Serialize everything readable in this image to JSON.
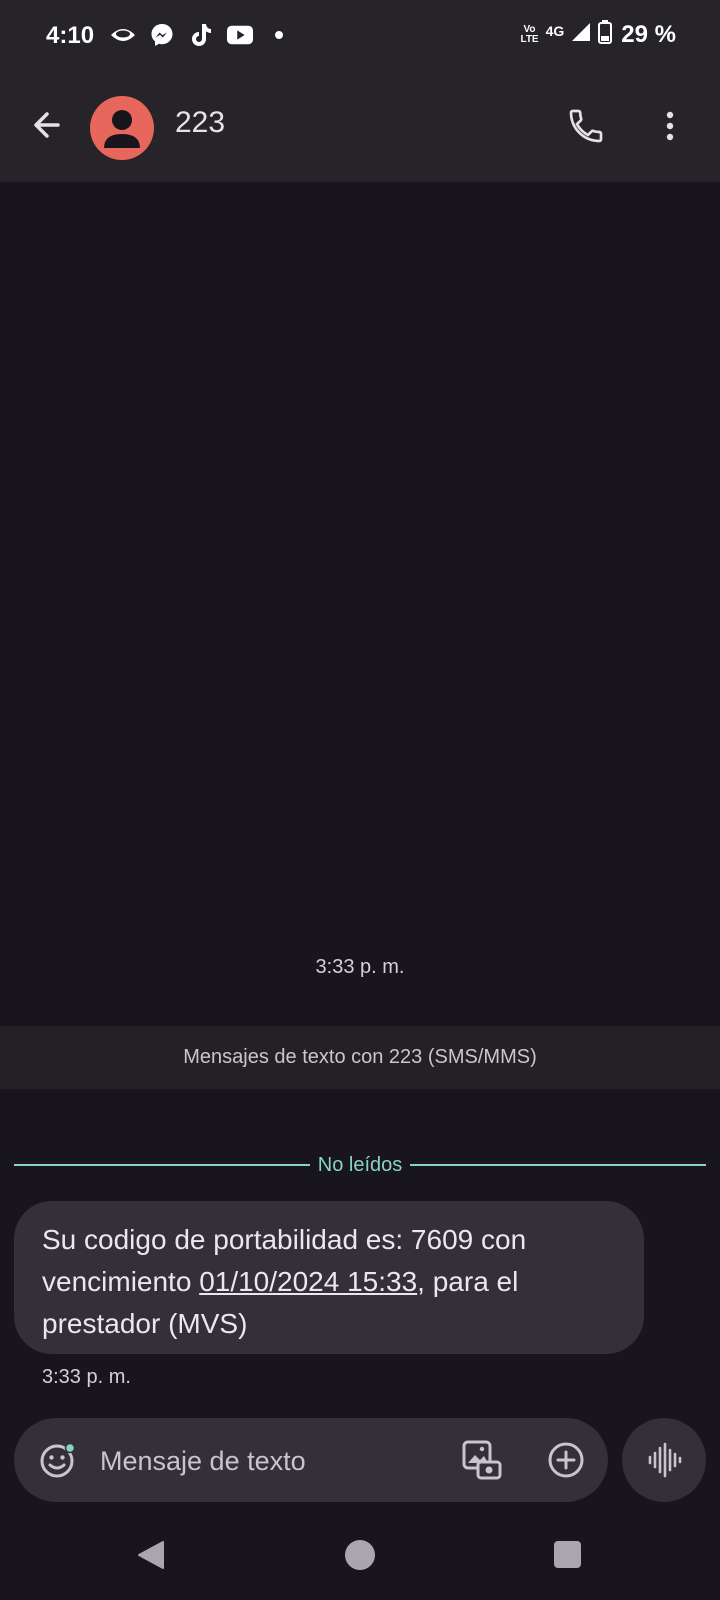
{
  "status_bar": {
    "time": "4:10",
    "network_top": "Vo",
    "network_bottom": "LTE",
    "network_type": "4G",
    "battery": "29 %",
    "notification_icons": [
      "eye-icon",
      "messenger-icon",
      "tiktok-icon",
      "youtube-icon",
      "dot-icon"
    ]
  },
  "app_bar": {
    "title": "223"
  },
  "conversation": {
    "first_timestamp": "3:33 p. m.",
    "info_banner": "Mensajes de texto con 223 (SMS/MMS)",
    "unread_label": "No leídos",
    "message": {
      "text_before": "Su codigo de portabilidad es: 7609 con vencimiento ",
      "link_text": "01/10/2024 15:33",
      "text_after": ", para el prestador (MVS)",
      "time": "3:33 p. m."
    }
  },
  "composer": {
    "placeholder": "Mensaje de texto"
  },
  "colors": {
    "background": "#19151c",
    "appbar": "#262329",
    "bubble": "#343037",
    "avatar": "#e8675d",
    "unread_accent": "#86d4c2"
  }
}
